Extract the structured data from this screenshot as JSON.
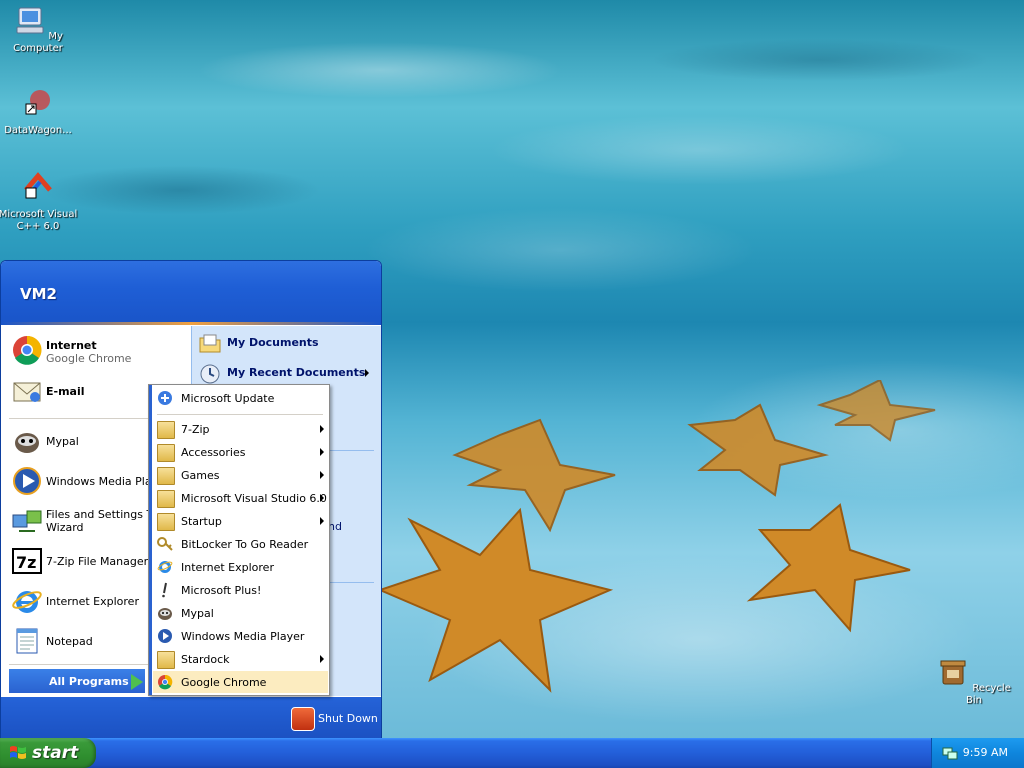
{
  "desktop": {
    "icons": [
      {
        "label": "My Computer",
        "icon": "computer-icon"
      },
      {
        "label": "DataWagon...",
        "icon": "datawagon-shortcut-icon"
      },
      {
        "label": "Microsoft Visual C++ 6.0",
        "icon": "visual-cpp-icon"
      },
      {
        "label": "Recycle Bin",
        "icon": "recycle-bin-icon"
      }
    ]
  },
  "start_menu": {
    "user": "VM2",
    "pinned": [
      {
        "title": "Internet",
        "subtitle": "Google Chrome",
        "icon": "chrome-icon"
      },
      {
        "title": "E-mail",
        "icon": "email-icon"
      }
    ],
    "recent": [
      {
        "title": "Mypal",
        "icon": "mypal-icon"
      },
      {
        "title": "Windows Media Player",
        "icon": "media-player-icon"
      },
      {
        "title": "Files and Settings Transfer Wizard",
        "line1": "Files and Settings Tra",
        "line2": "Wizard",
        "icon": "transfer-wizard-icon"
      },
      {
        "title": "7-Zip File Manager",
        "icon": "7zip-icon"
      },
      {
        "title": "Internet Explorer",
        "icon": "ie-icon"
      },
      {
        "title": "Notepad",
        "icon": "notepad-icon"
      }
    ],
    "all_programs": "All Programs",
    "right": [
      {
        "title": "My Documents",
        "icon": "documents-icon"
      },
      {
        "title": "My Recent Documents",
        "icon": "recent-docs-icon"
      }
    ],
    "right_partial": "nd",
    "shutdown": "Shut Down"
  },
  "programs_submenu": [
    {
      "title": "Microsoft Update",
      "icon": "update-icon",
      "arrow": false
    },
    {
      "title": "7-Zip",
      "icon": "folder-icon",
      "arrow": true
    },
    {
      "title": "Accessories",
      "icon": "folder-icon",
      "arrow": true
    },
    {
      "title": "Games",
      "icon": "folder-icon",
      "arrow": true
    },
    {
      "title": "Microsoft Visual Studio 6.0",
      "icon": "folder-icon",
      "arrow": true
    },
    {
      "title": "Startup",
      "icon": "folder-icon",
      "arrow": true
    },
    {
      "title": "BitLocker To Go Reader",
      "icon": "bitlocker-icon",
      "arrow": false
    },
    {
      "title": "Internet Explorer",
      "icon": "ie-icon",
      "arrow": false
    },
    {
      "title": "Microsoft Plus!",
      "icon": "plus-icon",
      "arrow": false
    },
    {
      "title": "Mypal",
      "icon": "mypal-icon",
      "arrow": false
    },
    {
      "title": "Windows Media Player",
      "icon": "media-player-icon",
      "arrow": false
    },
    {
      "title": "Stardock",
      "icon": "folder-icon",
      "arrow": true
    },
    {
      "title": "Google Chrome",
      "icon": "chrome-icon",
      "arrow": false,
      "highlighted": true
    }
  ],
  "taskbar": {
    "start_label": "start",
    "clock": "9:59 AM"
  }
}
